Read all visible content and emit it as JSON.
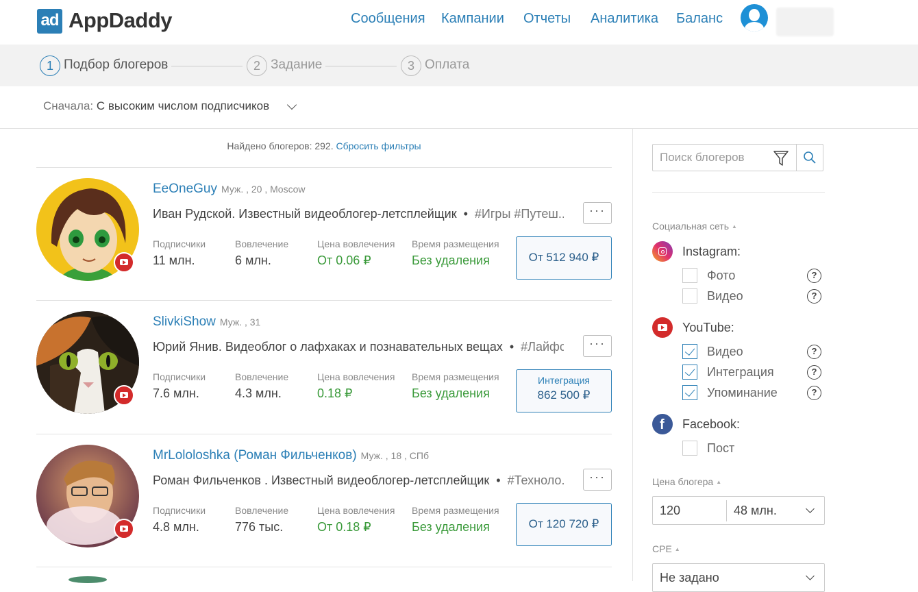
{
  "header": {
    "logo_mark": "ad",
    "logo_text": "AppDaddy",
    "nav": [
      "Сообщения",
      "Кампании",
      "Отчеты",
      "Аналитика",
      "Баланс"
    ]
  },
  "steps": [
    {
      "num": "1",
      "label": "Подбор блогеров"
    },
    {
      "num": "2",
      "label": "Задание"
    },
    {
      "num": "3",
      "label": "Оплата"
    }
  ],
  "sort": {
    "label": "Сначала:",
    "value": "С высоким числом подписчиков"
  },
  "results": {
    "found_text": "Найдено блогеров: 292.",
    "reset_label": "Сбросить фильтры"
  },
  "stat_labels": {
    "subscribers": "Подписчики",
    "engagement": "Вовлечение",
    "cpe": "Цена вовлечения",
    "time": "Время размещения"
  },
  "bloggers": [
    {
      "name": "EeOneGuy",
      "meta": "Муж. , 20 , Moscow",
      "desc": "Иван Рудской. Известный видеоблогер-летсплейщик",
      "tags": "#Игры  #Путеш...",
      "subscribers": "11 млн.",
      "engagement": "6 млн.",
      "cpe": "От 0.06 ₽",
      "time": "Без удаления",
      "price_sub": "",
      "price": "От 512 940 ₽"
    },
    {
      "name": "SlivkiShow",
      "meta": "Муж. , 31",
      "desc": "Юрий Янив. Видеоблог о лафхаках и познавательных вещах",
      "tags": "#Лайфс...",
      "subscribers": "7.6 млн.",
      "engagement": "4.3 млн.",
      "cpe": "0.18 ₽",
      "time": "Без удаления",
      "price_sub": "Интеграция",
      "price": "862 500 ₽"
    },
    {
      "name": "MrLololoshka (Роман Фильченков)",
      "meta": "Муж. , 18 , СПб",
      "desc": "Роман Фильченков . Известный видеоблогер-летсплейщик",
      "tags": "#Техноло...",
      "subscribers": "4.8 млн.",
      "engagement": "776 тыс.",
      "cpe": "От 0.18 ₽",
      "time": "Без удаления",
      "price_sub": "",
      "price": "От 120 720 ₽"
    }
  ],
  "more_label": "···",
  "sidebar": {
    "search_placeholder": "Поиск блогеров",
    "social_title": "Социальная сеть",
    "networks": [
      {
        "name": "Instagram:",
        "icon": "instagram-icon",
        "options": [
          {
            "label": "Фото",
            "checked": false
          },
          {
            "label": "Видео",
            "checked": false
          }
        ]
      },
      {
        "name": "YouTube:",
        "icon": "youtube-icon",
        "options": [
          {
            "label": "Видео",
            "checked": true
          },
          {
            "label": "Интеграция",
            "checked": true
          },
          {
            "label": "Упоминание",
            "checked": true
          }
        ]
      },
      {
        "name": "Facebook:",
        "icon": "facebook-icon",
        "options": [
          {
            "label": "Пост",
            "checked": false
          }
        ]
      }
    ],
    "help_symbol": "?",
    "price_title": "Цена блогера",
    "price_from": "120",
    "price_to": "48 млн.",
    "cpe_title": "CPE",
    "cpe_value": "Не задано"
  },
  "colors": {
    "brand": "#2b7fb6",
    "green": "#3a9a3a",
    "youtube": "#d32b2b",
    "facebook": "#3b5998"
  }
}
